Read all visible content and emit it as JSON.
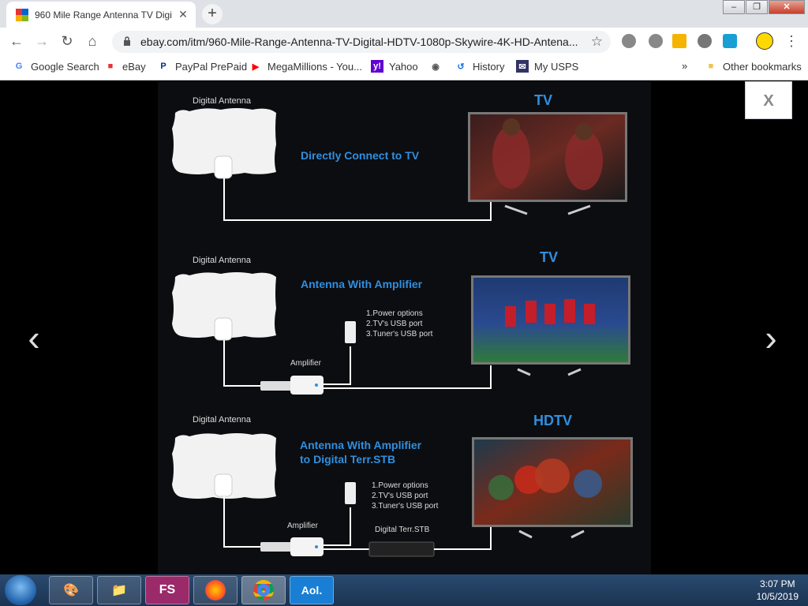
{
  "browser": {
    "tab_title": "960 Mile Range Antenna TV Digi",
    "tab_close": "✕",
    "new_tab": "+",
    "url": "ebay.com/itm/960-Mile-Range-Antenna-TV-Digital-HDTV-1080p-Skywire-4K-HD-Antena...",
    "window_buttons": {
      "minimize": "‒",
      "maximize": "❐",
      "close": "✕"
    }
  },
  "bookmarks": [
    {
      "label": "Google Search",
      "icon": "google-icon",
      "color": "#4285f4"
    },
    {
      "label": "eBay",
      "icon": "ebay-icon",
      "color": "#e53238"
    },
    {
      "label": "PayPal PrePaid",
      "icon": "paypal-icon",
      "color": "#003087"
    },
    {
      "label": "MegaMillions - You...",
      "icon": "youtube-icon",
      "color": "#ff0000"
    },
    {
      "label": "Yahoo",
      "icon": "yahoo-icon",
      "color": "#5f01d1"
    },
    {
      "label": "History",
      "icon": "history-icon",
      "color": "#1a73e8"
    },
    {
      "label": "My USPS",
      "icon": "usps-icon",
      "color": "#333366"
    }
  ],
  "other_bookmarks": "Other bookmarks",
  "bookmarks_overflow": "»",
  "viewer": {
    "close_label": "X",
    "prev_arrow": "‹",
    "next_arrow": "›"
  },
  "diagram": {
    "panels": [
      {
        "antenna_label": "Digital Antenna",
        "tv_label": "TV",
        "caption": "Directly Connect to TV"
      },
      {
        "antenna_label": "Digital Antenna",
        "tv_label": "TV",
        "caption": "Antenna With Amplifier",
        "power_options": [
          "1.Power options",
          "2.TV's USB port",
          "3.Tuner's USB port"
        ],
        "amplifier_label": "Amplifier"
      },
      {
        "antenna_label": "Digital Antenna",
        "tv_label": "HDTV",
        "caption_line1": "Antenna With Amplifier",
        "caption_line2": "to Digital Terr.STB",
        "power_options": [
          "1.Power options",
          "2.TV's USB port",
          "3.Tuner's USB port"
        ],
        "amplifier_label": "Amplifier",
        "stb_label": "Digital Terr.STB"
      }
    ],
    "accent_color": "#2f8fe0"
  },
  "taskbar": {
    "apps": [
      "paint",
      "explorer",
      "FS",
      "firefox",
      "chrome",
      "Aol."
    ],
    "time": "3:07 PM",
    "date": "10/5/2019"
  }
}
